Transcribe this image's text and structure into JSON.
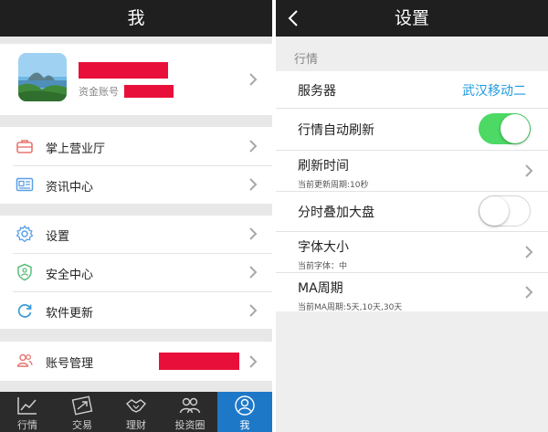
{
  "profile_screen": {
    "title": "我",
    "account_label": "资金账号",
    "menu_groups": [
      [
        {
          "label": "掌上营业厅",
          "icon": "briefcase-icon"
        },
        {
          "label": "资讯中心",
          "icon": "news-card-icon"
        }
      ],
      [
        {
          "label": "设置",
          "icon": "gear-icon"
        },
        {
          "label": "安全中心",
          "icon": "shield-icon"
        },
        {
          "label": "软件更新",
          "icon": "refresh-icon"
        }
      ],
      [
        {
          "label": "账号管理",
          "icon": "users-icon"
        }
      ]
    ],
    "tabs": [
      {
        "label": "行情",
        "icon": "chart-line-icon",
        "active": false
      },
      {
        "label": "交易",
        "icon": "trade-arrows-icon",
        "active": false
      },
      {
        "label": "理财",
        "icon": "handshake-icon",
        "active": false
      },
      {
        "label": "投资圈",
        "icon": "group-icon",
        "active": false
      },
      {
        "label": "我",
        "icon": "person-icon",
        "active": true
      }
    ]
  },
  "settings_screen": {
    "title": "设置",
    "section_label": "行情",
    "items": [
      {
        "label": "服务器",
        "value": "武汉移动二"
      },
      {
        "label": "行情自动刷新",
        "toggle": true
      },
      {
        "label": "刷新时间",
        "sub": "当前更新周期:10秒"
      },
      {
        "label": "分时叠加大盘",
        "toggle": false
      },
      {
        "label": "字体大小",
        "sub": "当前字体：中"
      },
      {
        "label": "MA周期",
        "sub": "当前MA周期:5天,10天,30天"
      }
    ]
  },
  "colors": {
    "topbar": "#1f1f1f",
    "accent_blue": "#1e9be0",
    "toggle_on": "#4cd964",
    "redaction": "#e8103a",
    "tab_active": "#1e78c8"
  }
}
